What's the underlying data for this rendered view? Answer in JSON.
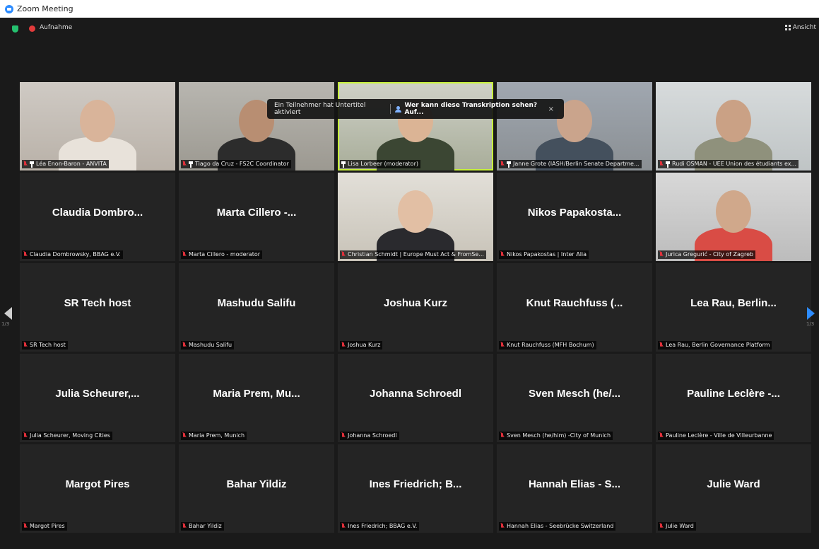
{
  "window": {
    "title": "Zoom Meeting"
  },
  "topbar": {
    "recording_label": "Aufnahme",
    "view_label": "Ansicht"
  },
  "banner": {
    "text": "Ein Teilnehmer hat Untertitel aktiviert",
    "link": "Wer kann diese Transkription sehen? Auf...",
    "close": "×"
  },
  "pagination": {
    "left": "1/3",
    "right": "1/3"
  },
  "tiles": [
    {
      "big": "",
      "label": "Léa Enon-Baron - ANVITA",
      "video": true,
      "pinned": true
    },
    {
      "big": "",
      "label": "Tiago da Cruz - FS2C Coordinator",
      "video": true,
      "pinned": true
    },
    {
      "big": "",
      "label": "Lisa Lorbeer (moderator)",
      "video": true,
      "pinned": true,
      "active": true,
      "unmuted": true
    },
    {
      "big": "",
      "label": "Janne Grote (IASH/Berlin Senate Departme...",
      "video": true,
      "pinned": true
    },
    {
      "big": "",
      "label": "Rudi OSMAN - UEE Union des étudiants ex...",
      "video": true,
      "pinned": true
    },
    {
      "big": "Claudia  Dombro...",
      "label": "Claudia Dombrowsky, BBAG e.V."
    },
    {
      "big": "Marta  Cillero  -...",
      "label": "Marta Cillero - moderator"
    },
    {
      "big": "",
      "label": "Christian Schmidt | Europe Must Act & FromSe...",
      "video": true
    },
    {
      "big": "Nikos  Papakosta...",
      "label": "Nikos Papakostas | Inter Alia"
    },
    {
      "big": "",
      "label": "Jurica Gregurić - City of Zagreb",
      "video": true
    },
    {
      "big": "SR Tech host",
      "label": "SR Tech host"
    },
    {
      "big": "Mashudu Salifu",
      "label": "Mashudu Salifu"
    },
    {
      "big": "Joshua Kurz",
      "label": "Joshua Kurz"
    },
    {
      "big": "Knut  Rauchfuss  (...",
      "label": "Knut Rauchfuss (MFH Bochum)"
    },
    {
      "big": "Lea  Rau,  Berlin...",
      "label": "Lea Rau, Berlin Governance Platform"
    },
    {
      "big": "Julia  Scheurer,...",
      "label": "Julia Scheurer, Moving Cities"
    },
    {
      "big": "Maria  Prem,  Mu...",
      "label": "Maria Prem, Munich"
    },
    {
      "big": "Johanna Schroedl",
      "label": "Johanna Schroedl"
    },
    {
      "big": "Sven  Mesch  (he/...",
      "label": "Sven Mesch (he/him) -City of Munich"
    },
    {
      "big": "Pauline  Leclère  -...",
      "label": "Pauline Leclère - Ville de Villeurbanne"
    },
    {
      "big": "Margot Pires",
      "label": "Margot Pires"
    },
    {
      "big": "Bahar Yildiz",
      "label": "Bahar Yildiz"
    },
    {
      "big": "Ines  Friedrich;  B...",
      "label": "Ines Friedrich; BBAG e.V."
    },
    {
      "big": "Hannah  Elias  -  S...",
      "label": "Hannah Elias - Seebrücke Switzerland"
    },
    {
      "big": "Julie Ward",
      "label": "Julie Ward"
    }
  ]
}
